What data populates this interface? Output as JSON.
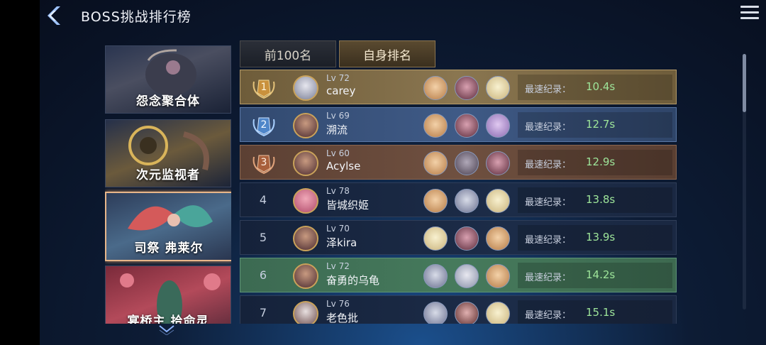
{
  "header": {
    "title": "BOSS挑战排行榜"
  },
  "bosses": [
    {
      "name": "怨念聚合体"
    },
    {
      "name": "次元监视者"
    },
    {
      "name": "司祭 弗莱尔",
      "selected": true
    },
    {
      "name": "宴桥主 拾命灵"
    }
  ],
  "tabs": [
    {
      "label": "前100名",
      "active": false
    },
    {
      "label": "自身排名",
      "active": true
    }
  ],
  "record_label": "最速纪录：",
  "ranking": [
    {
      "rank": "1",
      "level": "Lv 72",
      "name": "carey",
      "time": "10.4s"
    },
    {
      "rank": "2",
      "level": "Lv 69",
      "name": "溯流",
      "time": "12.7s"
    },
    {
      "rank": "3",
      "level": "Lv 60",
      "name": "Acylse",
      "time": "12.9s"
    },
    {
      "rank": "4",
      "level": "Lv 78",
      "name": "皆城织姬",
      "time": "13.8s"
    },
    {
      "rank": "5",
      "level": "Lv 70",
      "name": "泽kira",
      "time": "13.9s"
    },
    {
      "rank": "6",
      "level": "Lv 72",
      "name": "奋勇的乌龟",
      "time": "14.2s"
    },
    {
      "rank": "7",
      "level": "Lv 76",
      "name": "老色批",
      "time": "15.1s"
    }
  ]
}
